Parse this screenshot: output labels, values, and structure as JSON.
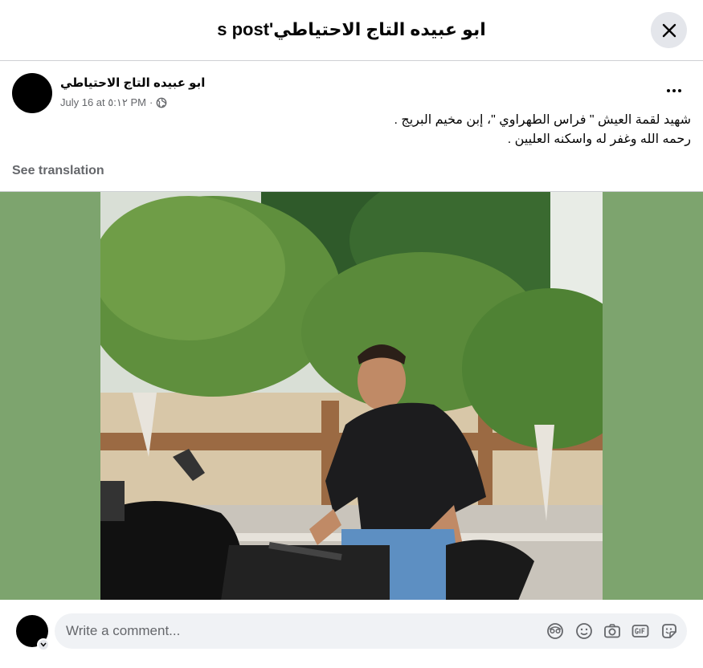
{
  "header": {
    "title": "ابو عبيده التاج الاحتياطي's post"
  },
  "post": {
    "author": "ابو عبيده التاج الاحتياطي",
    "timestamp": "July 16 at ٥:١٢ PM",
    "separator": "·",
    "privacy_icon": "globe-icon",
    "text_line1": "شهيد لقمة العيش \" فراس الطهراوي \"، إبن مخيم البريج .",
    "text_line2": "رحمه الله وغفر له واسكنه العليين .",
    "see_translation": "See translation"
  },
  "comment": {
    "placeholder": "Write a comment...",
    "icons": [
      "avatar-icon",
      "emoji-icon",
      "camera-icon",
      "gif-icon",
      "sticker-icon"
    ]
  },
  "colors": {
    "photo_background": "#7da46e",
    "secondary_text": "#65676b",
    "input_background": "#f0f2f5"
  }
}
